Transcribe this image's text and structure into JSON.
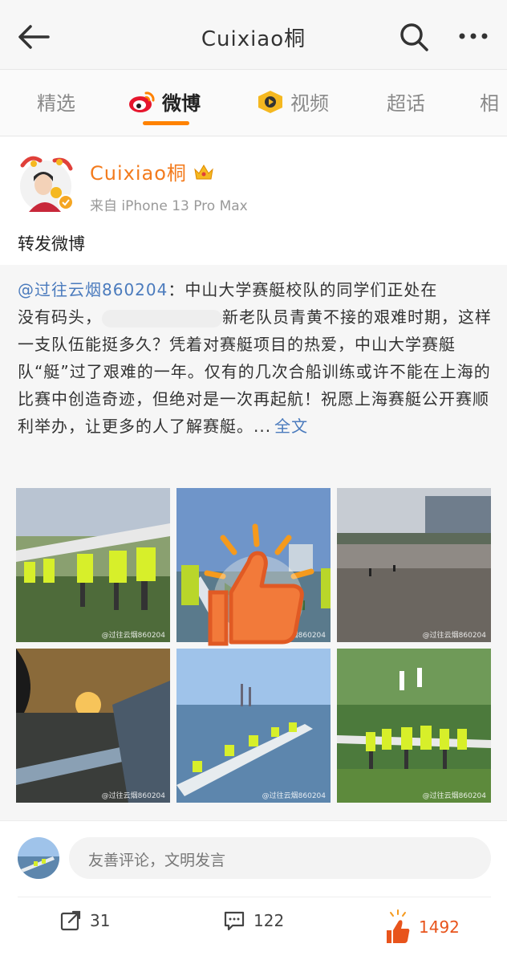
{
  "header": {
    "title": "Cuixiao桐"
  },
  "tabs": [
    {
      "label": "精选"
    },
    {
      "label": "微博"
    },
    {
      "label": "视频"
    },
    {
      "label": "超话"
    },
    {
      "label": "相"
    }
  ],
  "post": {
    "author": "Cuixiao桐",
    "source": "来自 iPhone 13 Pro Max",
    "text": "转发微博"
  },
  "repost": {
    "mention": "@过往云烟860204",
    "line1_rest": "：中山大学赛艇校队的同学们正处在",
    "line2_a": "没有码头，",
    "line2_b": "新老队员青黄不接的艰难时",
    "rest": "期，这样一支队伍能挺多久？凭着对赛艇项目的热爱，中山大学赛艇队“艇”过了艰难的一年。仅有的几次合船训练或许不能在上海的比赛中创造奇迹，但绝对是一次再起航！祝愿上海赛艇公开赛顺利举办，让更多的人了解赛艇。...",
    "full_text_link": "全文",
    "watermark": "@过往云烟860204"
  },
  "comment": {
    "placeholder": "友善评论，文明发言"
  },
  "actions": {
    "repost_count": "31",
    "comment_count": "122",
    "like_count": "1492"
  },
  "colors": {
    "accent": "#ff8200",
    "name": "#f37b1d",
    "link": "#4b7bbd",
    "like": "#e8541c"
  }
}
